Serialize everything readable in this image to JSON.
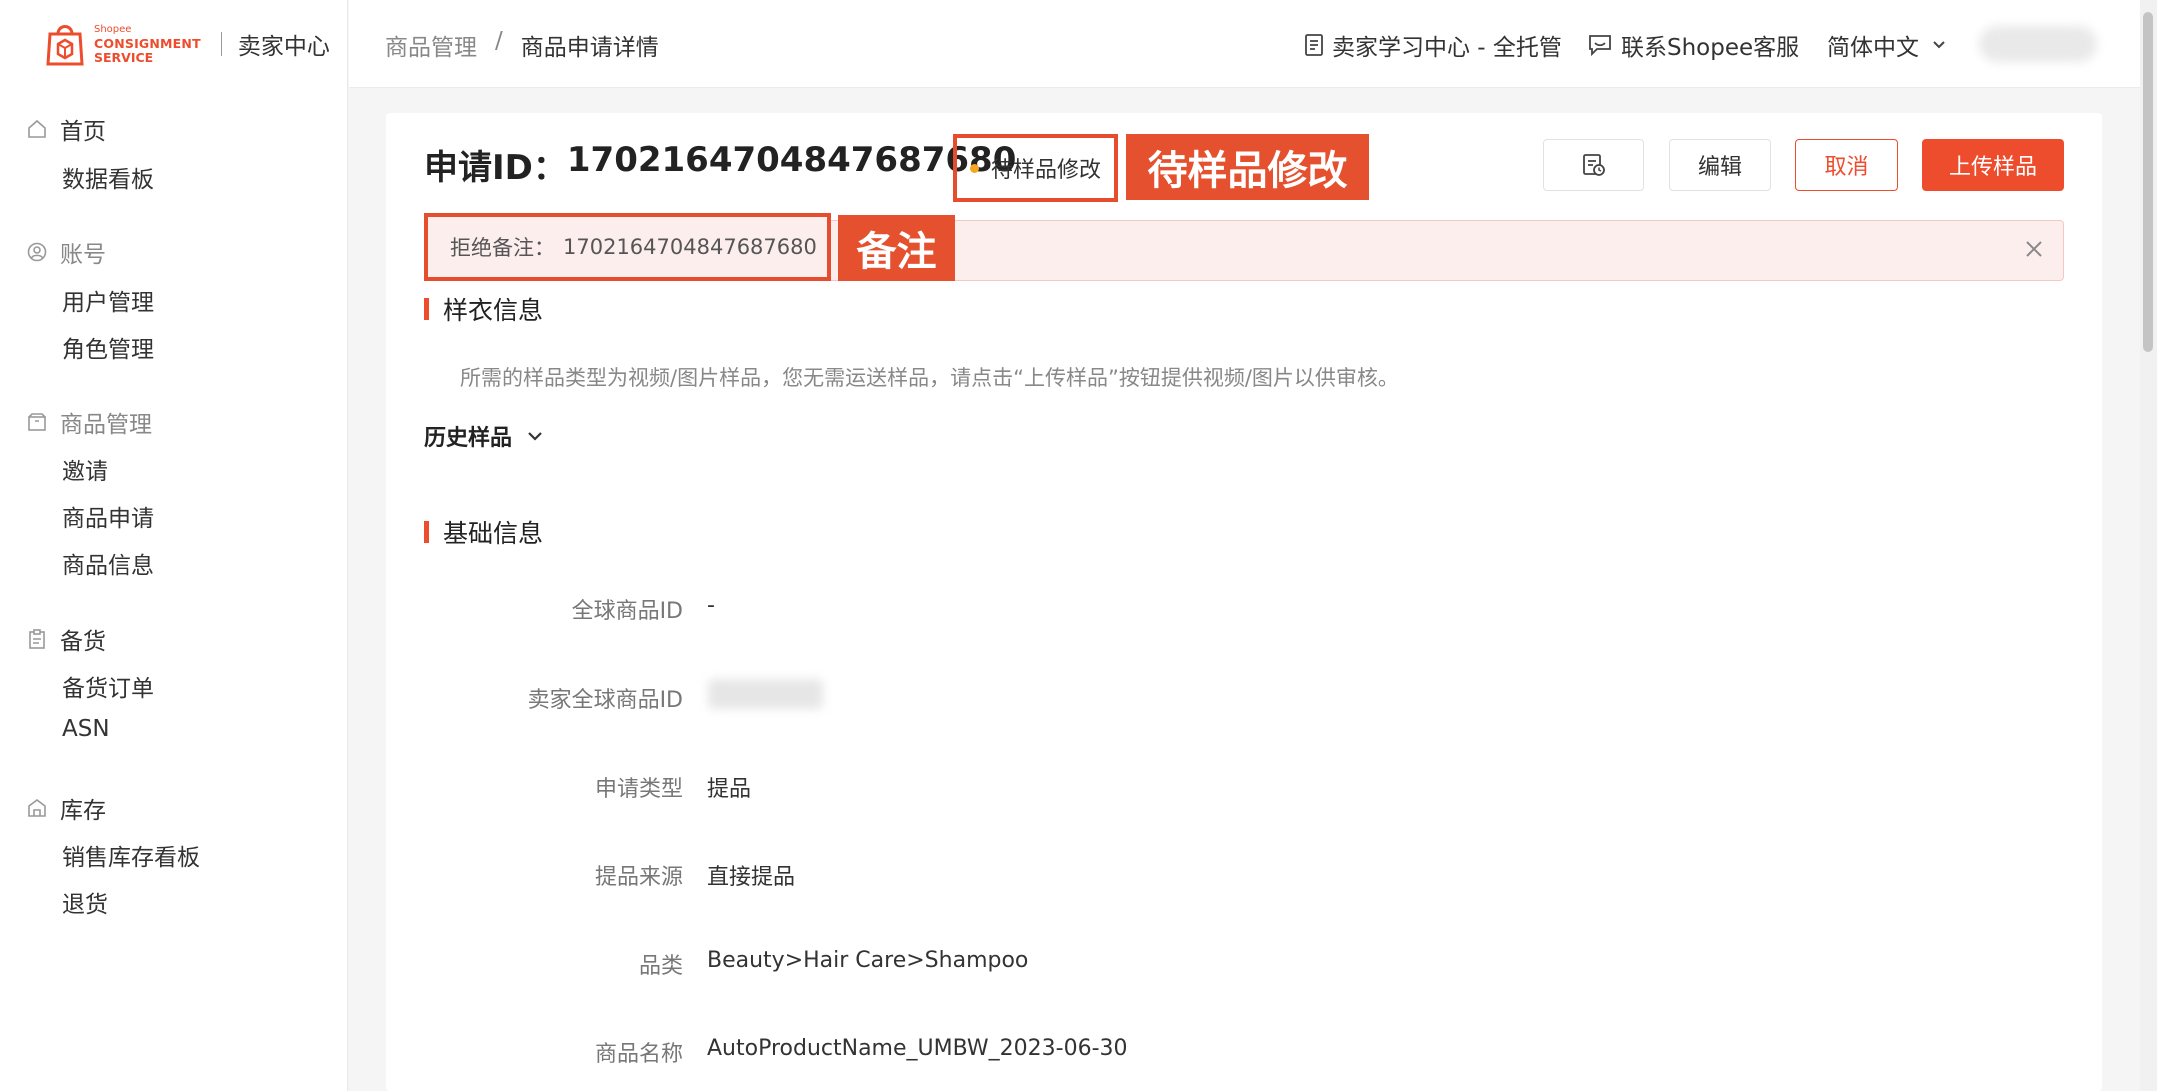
{
  "logo": {
    "line1": "Shopee",
    "line2": "CONSIGNMENT",
    "line3": "SERVICE",
    "title": "卖家中心"
  },
  "sidebar": {
    "groups": [
      {
        "label": "首页",
        "icon": "home-icon",
        "items": [
          "数据看板"
        ]
      },
      {
        "label": "账号",
        "icon": "user-circle-icon",
        "items": [
          "用户管理",
          "角色管理"
        ]
      },
      {
        "label": "商品管理",
        "icon": "box-icon",
        "items": [
          "邀请",
          "商品申请",
          "商品信息"
        ]
      },
      {
        "label": "备货",
        "icon": "clipboard-icon",
        "items": [
          "备货订单",
          "ASN"
        ]
      },
      {
        "label": "库存",
        "icon": "warehouse-icon",
        "items": [
          "销售库存看板",
          "退货"
        ]
      }
    ]
  },
  "header": {
    "breadcrumb": [
      "商品管理",
      "商品申请详情"
    ],
    "learning_center": "卖家学习中心 - 全托管",
    "contact": "联系Shopee客服",
    "language": "简体中文"
  },
  "detail": {
    "id_label": "申请ID：",
    "id_value": "1702164704847687680",
    "status": "待样品修改",
    "annotations": {
      "status": "待样品修改",
      "remark": "备注"
    },
    "buttons": {
      "edit": "编辑",
      "cancel": "取消",
      "upload": "上传样品"
    },
    "reject_label": "拒绝备注：",
    "reject_value": "1702164704847687680",
    "sample_section": "样衣信息",
    "sample_hint": "所需的样品类型为视频/图片样品，您无需运送样品，请点击“上传样品”按钮提供视频/图片以供审核。",
    "history": "历史样品",
    "basic_section": "基础信息",
    "fields": [
      {
        "label": "全球商品ID",
        "value": "-"
      },
      {
        "label": "卖家全球商品ID",
        "value": ""
      },
      {
        "label": "申请类型",
        "value": "提品"
      },
      {
        "label": "提品来源",
        "value": "直接提品"
      },
      {
        "label": "品类",
        "value": "Beauty>Hair Care>Shampoo"
      },
      {
        "label": "商品名称",
        "value": "AutoProductName_UMBW_2023-06-30"
      }
    ]
  },
  "colors": {
    "brand": "#ee4d2d",
    "status_dot": "#f5a623",
    "reject_bg": "#fdeeee"
  }
}
